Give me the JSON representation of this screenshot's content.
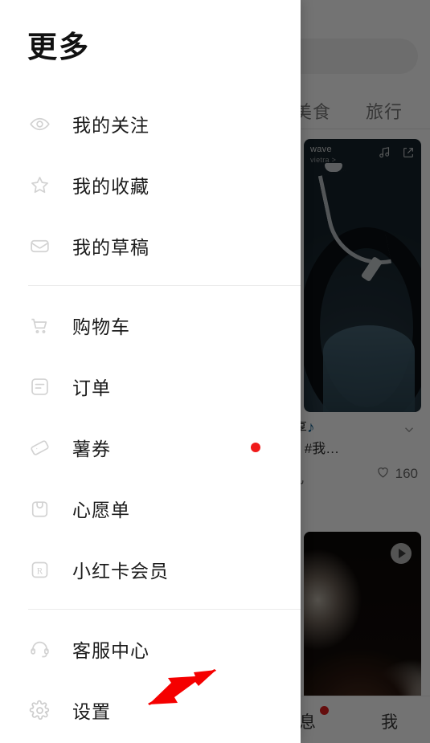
{
  "drawer": {
    "title": "更多",
    "menu": [
      {
        "label": "我的关注",
        "icon": "eye-icon",
        "badge": false
      },
      {
        "label": "我的收藏",
        "icon": "star-icon",
        "badge": false
      },
      {
        "label": "我的草稿",
        "icon": "inbox-icon",
        "badge": false
      },
      {
        "divider": true
      },
      {
        "label": "购物车",
        "icon": "shopping-cart-icon",
        "badge": false
      },
      {
        "label": "订单",
        "icon": "order-receipt-icon",
        "badge": false
      },
      {
        "label": "薯券",
        "icon": "coupon-tag-icon",
        "badge": true
      },
      {
        "label": "心愿单",
        "icon": "wishlist-bag-icon",
        "badge": false
      },
      {
        "label": "小红卡会员",
        "icon": "membership-card-icon",
        "badge": false
      },
      {
        "divider": true
      },
      {
        "label": "客服中心",
        "icon": "headset-support-icon",
        "badge": false
      },
      {
        "label": "设置",
        "icon": "gear-icon",
        "badge": false
      }
    ]
  },
  "background": {
    "search_placeholder": "",
    "tabs": [
      {
        "label": "美食"
      },
      {
        "label": "旅行"
      }
    ],
    "feed": [
      {
        "overlay_title": "wave",
        "overlay_sub": "vietra >",
        "title_line1": "分享",
        "title_note": "♪",
        "title_line2": "歌单 #我…",
        "author": "儿",
        "likes": "160",
        "music_icon": "music-note-icon",
        "share_icon": "share-external-icon",
        "chevron_icon": "chevron-down-icon",
        "like_icon": "heart-icon"
      },
      {
        "play_icon": "play-circle-icon"
      }
    ],
    "bottom_nav": [
      {
        "label": "息",
        "badge": true
      },
      {
        "label": "我",
        "badge": false
      }
    ]
  },
  "annotation": {
    "arrow": "red-arrow-pointing-to-settings",
    "color": "#f50000"
  },
  "colors": {
    "badge_red": "#f01a1a",
    "annotation_red": "#f50000",
    "text_primary": "#1b1b1b",
    "icon_grey": "#cfcfcf",
    "divider": "#ebebeb",
    "drawer_bg": "#ffffff"
  }
}
